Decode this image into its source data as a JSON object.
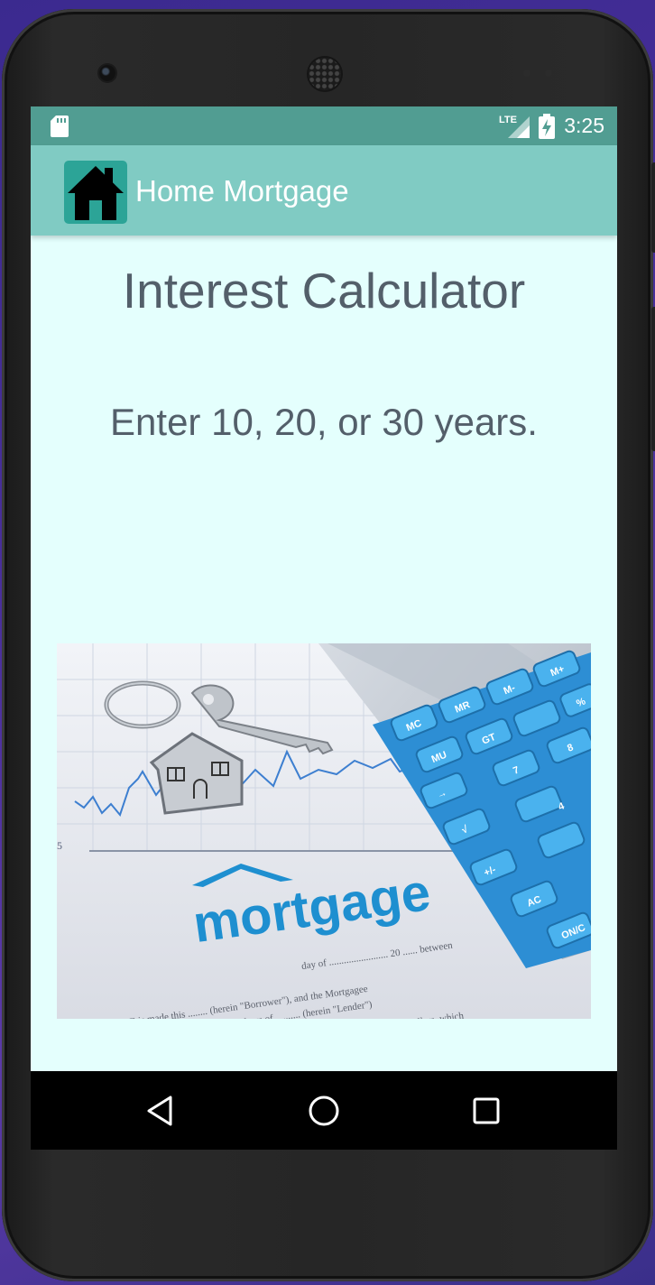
{
  "status_bar": {
    "network": "LTE",
    "time": "3:25"
  },
  "app_bar": {
    "title": "Home Mortgage",
    "icon": "house-icon"
  },
  "main": {
    "heading": "Interest Calculator",
    "instruction": "Enter 10, 20, or 30 years.",
    "image": {
      "subject": "mortgage-photo",
      "word": "mortgage",
      "calculator_keys": [
        "MC",
        "MR",
        "M-",
        "M+",
        "MU",
        "GT",
        "%",
        "→",
        "7",
        "8",
        "√",
        "4",
        "+/-",
        "AC",
        "ON/C"
      ],
      "document_lines": [
        "day of ........................ 20 ...... between",
        "IS MORTGAGE is made this ........ (herein \"Borrower\"), and the Mortgagee",
        "organized and existing under the laws of .......... (herein \"Lender\")",
        "whose address is ........................ Dollars, which"
      ]
    }
  },
  "nav_bar": {
    "back": "back-icon",
    "home": "home-circle-icon",
    "recents": "recents-square-icon"
  },
  "colors": {
    "status_bar": "#519d92",
    "app_bar": "#80cbc3",
    "background": "#e4fffd",
    "text": "#535f6a",
    "accent": "#1e8fd0"
  }
}
